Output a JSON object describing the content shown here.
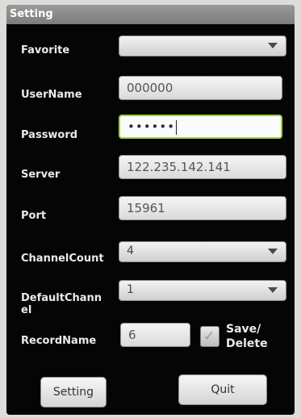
{
  "window": {
    "title": "Setting"
  },
  "form": {
    "favorite": {
      "label": "Favorite",
      "value": ""
    },
    "username": {
      "label": "UserName",
      "value": "000000"
    },
    "password": {
      "label": "Password",
      "masked": "••••••"
    },
    "server": {
      "label": "Server",
      "value": "122.235.142.141"
    },
    "port": {
      "label": "Port",
      "value": "15961"
    },
    "channel_count": {
      "label": "ChannelCount",
      "value": "4"
    },
    "default_channel": {
      "label_line1": "DefaultChann",
      "label_line2": "el",
      "value": "1"
    },
    "record_name": {
      "label": "RecordName",
      "value": "6"
    },
    "save_delete": {
      "label_line1": "Save/",
      "label_line2": "Delete",
      "checked": true
    }
  },
  "buttons": {
    "setting": "Setting",
    "quit": "Quit"
  },
  "colors": {
    "focus_border": "#9ccf45",
    "background": "#050505",
    "title_bar": "#8a8a8a"
  },
  "icons": {
    "dropdown": "triangle-down-icon",
    "checkbox": "check-icon"
  }
}
